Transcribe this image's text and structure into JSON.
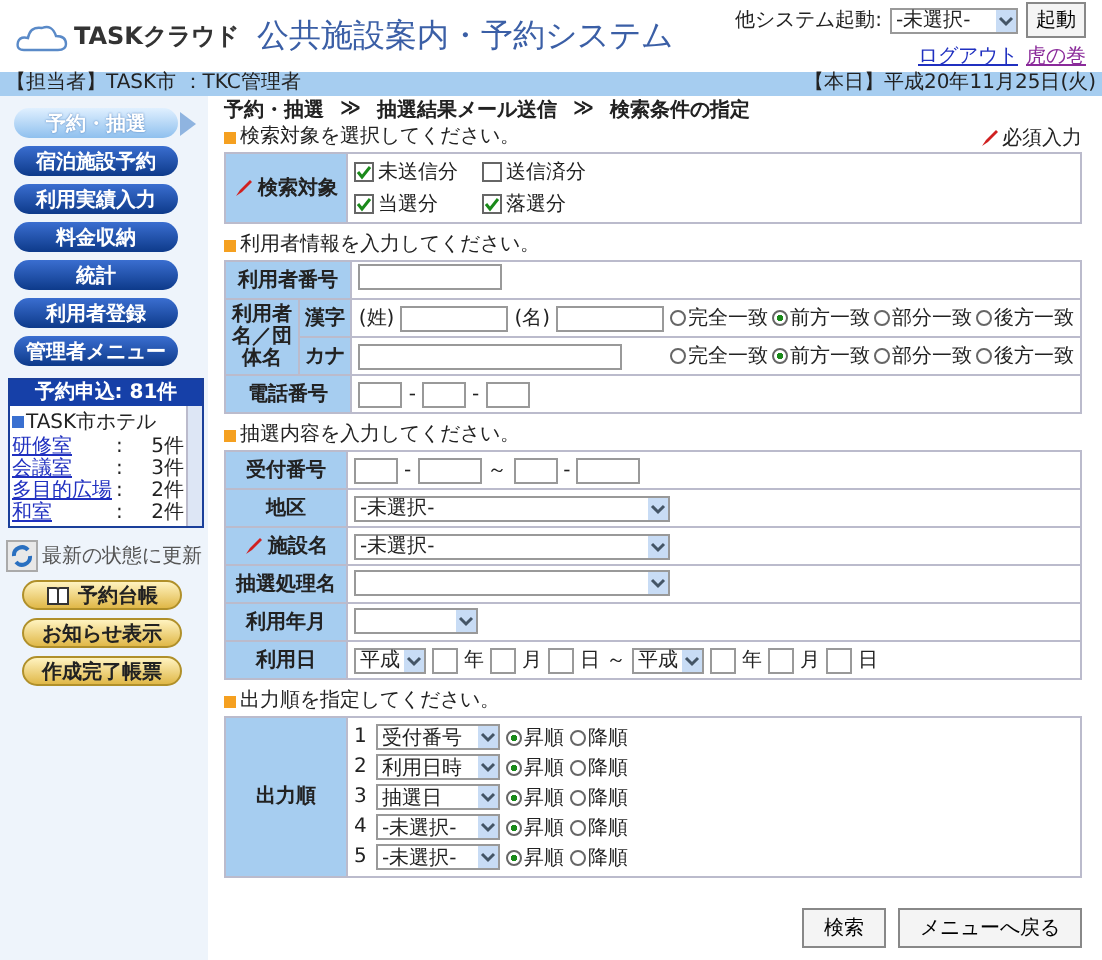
{
  "header": {
    "brand": "TASKクラウド",
    "title": "公共施設案内・予約システム",
    "system_label": "他システム起動:",
    "system_select": "-未選択-",
    "launch_button": "起動",
    "links": [
      "ログアウト",
      "虎の巻"
    ]
  },
  "info_bar": {
    "user": "【担当者】TASK市 ：TKC管理者",
    "date": "【本日】平成20年11月25日(火)"
  },
  "breadcrumb": [
    "予約・抽選",
    "≫",
    "抽選結果メール送信",
    "≫",
    "検索条件の指定"
  ],
  "sidebar": {
    "nav": [
      {
        "label": "予約・抽選",
        "selected": true
      },
      {
        "label": "宿泊施設予約",
        "selected": false
      },
      {
        "label": "利用実績入力",
        "selected": false
      },
      {
        "label": "料金収納",
        "selected": false
      },
      {
        "label": "統計",
        "selected": false
      },
      {
        "label": "利用者登録",
        "selected": false
      },
      {
        "label": "管理者メニュー",
        "selected": false
      }
    ],
    "requests": {
      "title": "予約申込: 81件",
      "group": "TASK市ホテル",
      "items": [
        {
          "name": "研修室",
          "sep": ":",
          "count": "5件"
        },
        {
          "name": "会議室",
          "sep": ":",
          "count": "3件"
        },
        {
          "name": "多目的広場",
          "sep": ":",
          "count": "2件"
        },
        {
          "name": "和室",
          "sep": ":",
          "count": "2件"
        }
      ]
    },
    "refresh": "最新の状態に更新",
    "buttons": [
      {
        "label": "予約台帳",
        "kind": "book"
      },
      {
        "label": "お知らせ表示",
        "kind": "plain"
      },
      {
        "label": "作成完了帳票",
        "kind": "plain"
      }
    ]
  },
  "required_note": "必須入力",
  "target": {
    "heading": "検索対象を選択してください。",
    "label": "検索対象",
    "options": [
      {
        "label": "未送信分",
        "checked": true
      },
      {
        "label": "送信済分",
        "checked": false
      },
      {
        "label": "当選分",
        "checked": true
      },
      {
        "label": "落選分",
        "checked": true
      }
    ]
  },
  "user_info": {
    "heading": "利用者情報を入力してください。",
    "number_label": "利用者番号",
    "name_label": "利用者名／団体名",
    "kanji_label": "漢字",
    "sei": "(姓)",
    "mei": "(名)",
    "kana_label": "カナ",
    "phone_label": "電話番号",
    "phone_dashes": [
      "-",
      "-"
    ],
    "kanji_match": [
      {
        "label": "完全一致",
        "selected": false
      },
      {
        "label": "前方一致",
        "selected": true
      },
      {
        "label": "部分一致",
        "selected": false
      },
      {
        "label": "後方一致",
        "selected": false
      }
    ],
    "kana_match": [
      {
        "label": "完全一致",
        "selected": false
      },
      {
        "label": "前方一致",
        "selected": true
      },
      {
        "label": "部分一致",
        "selected": false
      },
      {
        "label": "後方一致",
        "selected": false
      }
    ]
  },
  "lottery": {
    "heading": "抽選内容を入力してください。",
    "receipt_label": "受付番号",
    "receipt_dashes": [
      "-",
      "-"
    ],
    "receipt_tilde": "～",
    "area_label": "地区",
    "area_value": "-未選択-",
    "facility_label": "施設名",
    "facility_value": "-未選択-",
    "process_label": "抽選処理名",
    "month_label": "利用年月",
    "date_label": "利用日",
    "date_range": [
      {
        "era": "平成",
        "year": "年",
        "month": "月",
        "day": "日"
      },
      {
        "era": "平成",
        "year": "年",
        "month": "月",
        "day": "日"
      }
    ],
    "date_tilde": "～"
  },
  "sort": {
    "heading": "出力順を指定してください。",
    "label": "出力順",
    "rows": [
      {
        "no": "1",
        "value": "受付番号",
        "asc_label": "昇順",
        "desc_label": "降順",
        "asc": true
      },
      {
        "no": "2",
        "value": "利用日時",
        "asc_label": "昇順",
        "desc_label": "降順",
        "asc": true
      },
      {
        "no": "3",
        "value": "抽選日",
        "asc_label": "昇順",
        "desc_label": "降順",
        "asc": true
      },
      {
        "no": "4",
        "value": "-未選択-",
        "asc_label": "昇順",
        "desc_label": "降順",
        "asc": true
      },
      {
        "no": "5",
        "value": "-未選択-",
        "asc_label": "昇順",
        "desc_label": "降順",
        "asc": true
      }
    ]
  },
  "actions": [
    "検索",
    "メニューへ戻る"
  ]
}
